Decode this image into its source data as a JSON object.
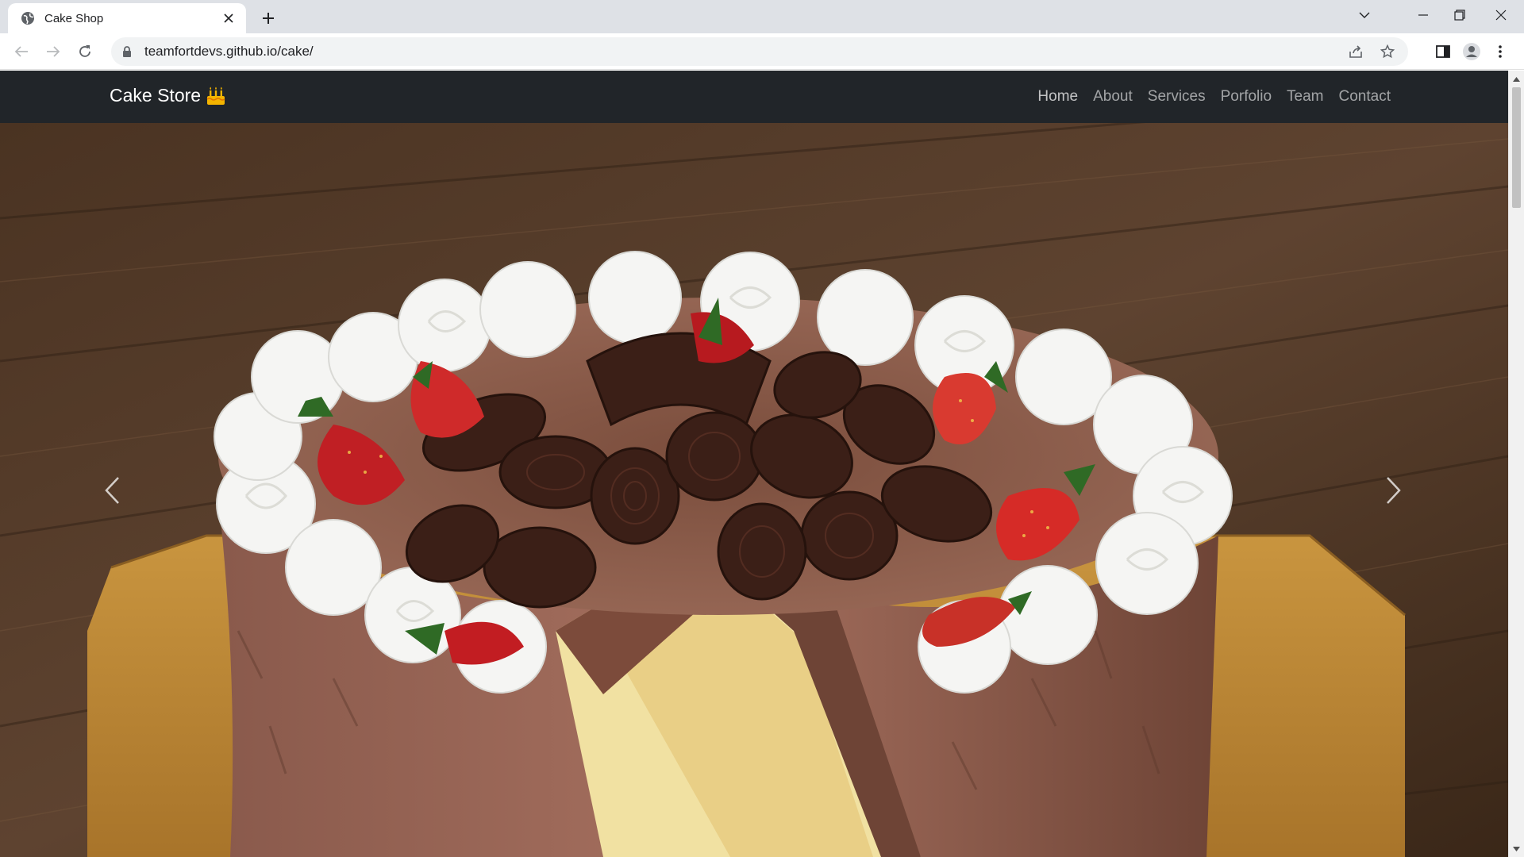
{
  "browser": {
    "tab": {
      "title": "Cake Shop"
    },
    "omnibox": {
      "url": "teamfortdevs.github.io/cake/"
    }
  },
  "site": {
    "brand": "Cake Store",
    "brand_icon": "birthday-cake-icon",
    "nav": [
      {
        "label": "Home"
      },
      {
        "label": "About"
      },
      {
        "label": "Services"
      },
      {
        "label": "Porfolio"
      },
      {
        "label": "Team"
      },
      {
        "label": "Contact"
      }
    ]
  },
  "carousel": {
    "slide_image": "chocolate-cake-with-strawberries",
    "prev_icon": "chevron-left-icon",
    "next_icon": "chevron-right-icon"
  },
  "colors": {
    "navbar_bg": "#212529",
    "tabbar_bg": "#dee1e6",
    "omnibox_bg": "#f1f3f4"
  }
}
